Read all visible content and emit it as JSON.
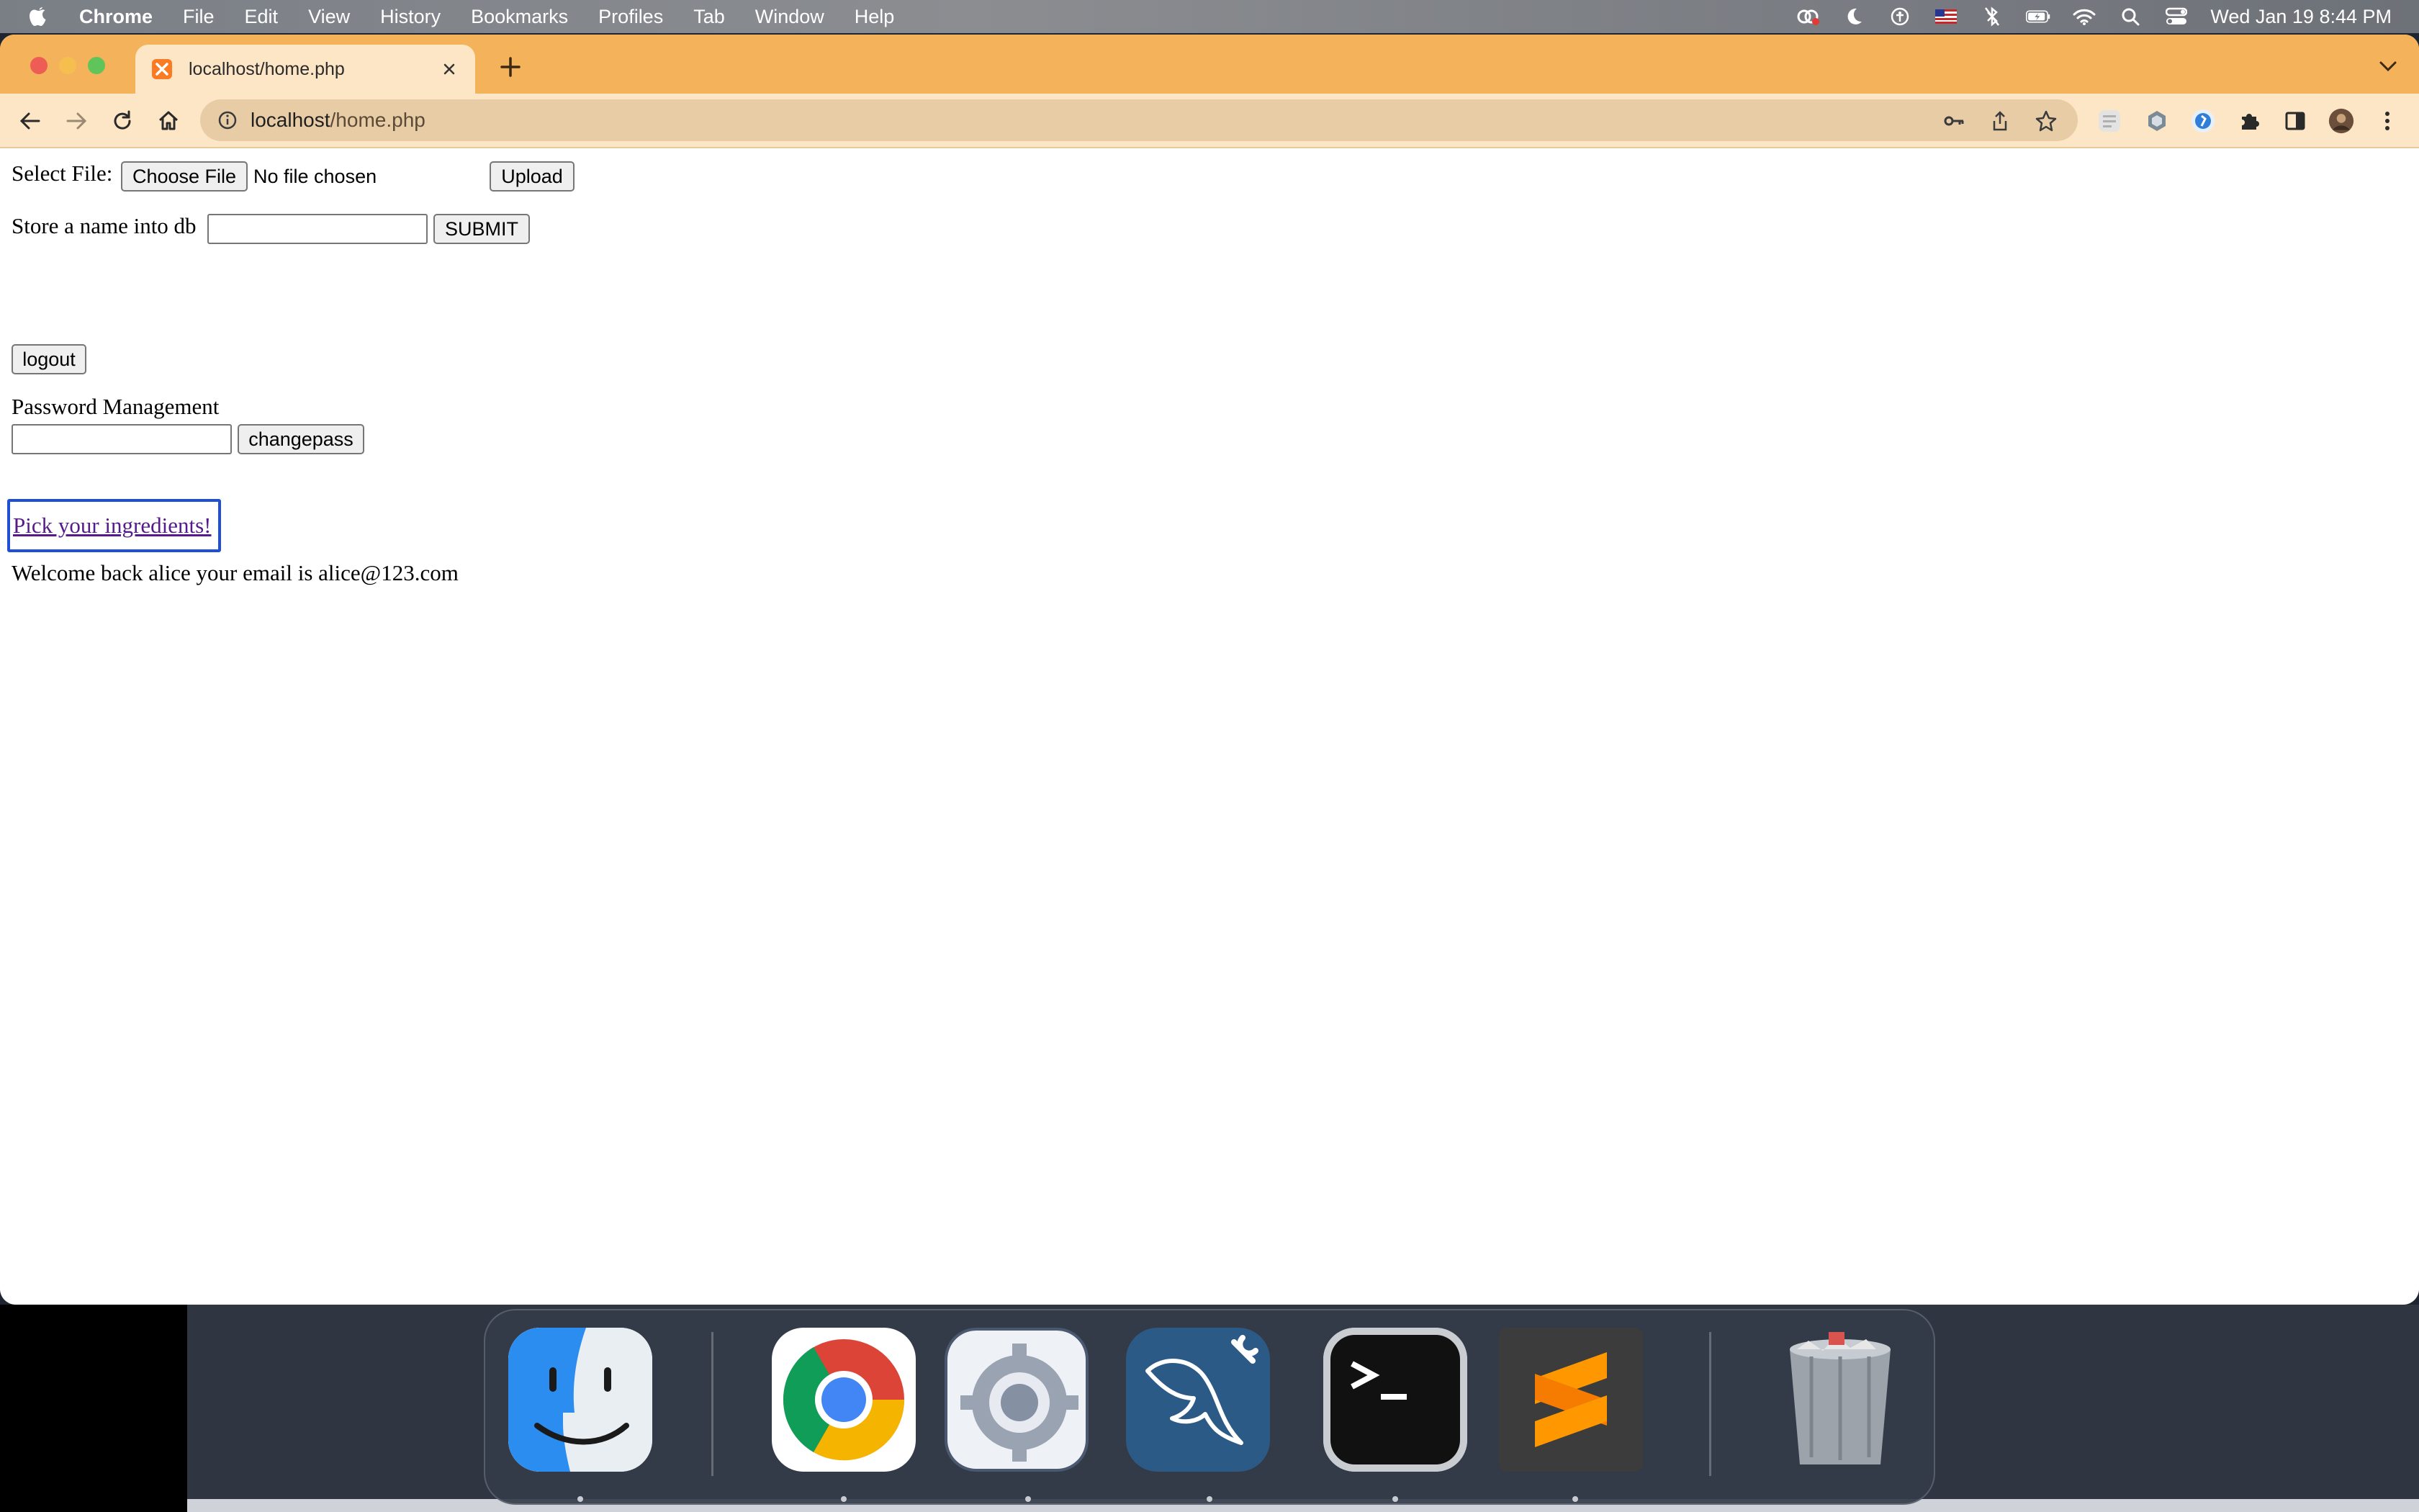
{
  "menubar": {
    "app_name": "Chrome",
    "menus": [
      "File",
      "Edit",
      "View",
      "History",
      "Bookmarks",
      "Profiles",
      "Tab",
      "Window",
      "Help"
    ],
    "clock": "Wed Jan 19  8:44 PM"
  },
  "browser": {
    "tab_title": "localhost/home.php",
    "url_host": "localhost",
    "url_path": "/home.php",
    "accent_color": "#f4b25b"
  },
  "page": {
    "select_file_label": "Select File:",
    "choose_file_button": "Choose File",
    "no_file_text": "No file chosen",
    "upload_button": "Upload",
    "store_name_label": "Store a name into db",
    "submit_button": "SUBMIT",
    "logout_button": "logout",
    "password_heading": "Password Management",
    "changepass_button": "changepass",
    "ingredients_link": "Pick your ingredients!",
    "welcome_text": "Welcome back alice your email is alice@123.com"
  },
  "dock": {
    "apps": [
      "finder-icon",
      "chrome-icon",
      "system-preferences-icon",
      "mysql-workbench-icon",
      "terminal-icon",
      "sublime-text-icon",
      "trash-icon"
    ]
  }
}
